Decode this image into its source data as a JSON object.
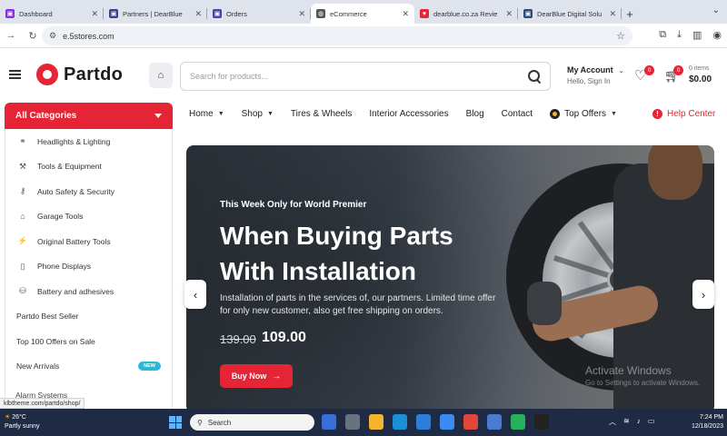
{
  "browser": {
    "tabs": [
      {
        "title": "Dashboard",
        "fav_color": "#8a2be2",
        "fav_text": "▣",
        "active": false
      },
      {
        "title": "Partners | DearBlue",
        "fav_color": "#3b3f8f",
        "fav_text": "▣",
        "active": false
      },
      {
        "title": "Orders",
        "fav_color": "#4b3fb0",
        "fav_text": "▣",
        "active": false
      },
      {
        "title": "eCommerce",
        "fav_color": "#555555",
        "fav_text": "◍",
        "active": true
      },
      {
        "title": "dearblue.co.za Revie",
        "fav_color": "#e52535",
        "fav_text": "♥",
        "active": false
      },
      {
        "title": "DearBlue Digital Solu",
        "fav_color": "#2b4a7a",
        "fav_text": "▣",
        "active": false
      }
    ],
    "new_tab": "+",
    "url": "e.5stores.com"
  },
  "header": {
    "logo": "Partdo",
    "search_placeholder": "Search for products...",
    "account_title": "My Account",
    "account_sub": "Hello, Sign In",
    "wishlist_count": "0",
    "cart_count": "0",
    "cart_items": "0 items",
    "cart_total": "$0.00"
  },
  "categories": {
    "title": "All Categories",
    "items": [
      {
        "label": "Headlights & Lighting",
        "icon": "⚭"
      },
      {
        "label": "Tools & Equipment",
        "icon": "⚒"
      },
      {
        "label": "Auto Safety & Security",
        "icon": "⚷"
      },
      {
        "label": "Garage Tools",
        "icon": "⌂"
      },
      {
        "label": "Original Battery Tools",
        "icon": "⚡"
      },
      {
        "label": "Phone Displays",
        "icon": "▯"
      },
      {
        "label": "Battery and adhesives",
        "icon": "⛁"
      },
      {
        "label": "Partdo Best Seller",
        "icon": ""
      },
      {
        "label": "Top 100 Offers on Sale",
        "icon": ""
      },
      {
        "label": "New Arrivals",
        "icon": "",
        "badge": "NEW"
      }
    ],
    "partial": "Alarm Systems"
  },
  "nav": {
    "items": [
      "Home",
      "Shop",
      "Tires & Wheels",
      "Interior Accessories",
      "Blog",
      "Contact",
      "Top Offers"
    ],
    "help": "Help Center"
  },
  "hero": {
    "kicker": "This Week Only for World Premier",
    "headline": "When Buying Parts With Installation",
    "subtext": "Installation of parts in the services of, our partners. Limited time offer for only new customer, also get free shipping on orders.",
    "old_price": "139.00",
    "new_price": "109.00",
    "button": "Buy Now",
    "watermark_title": "Activate Windows",
    "watermark_sub": "Go to Settings to activate Windows."
  },
  "status_link": "klbtheme.com/partdo/shop/",
  "taskbar": {
    "temp": "26°C",
    "weather": "Partly sunny",
    "search": "Search",
    "time": "7:24 PM",
    "date": "12/18/2023"
  }
}
